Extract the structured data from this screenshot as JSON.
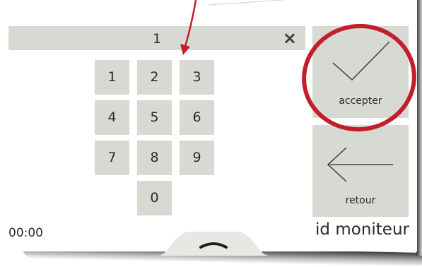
{
  "display": {
    "value": "1"
  },
  "icons": {
    "clear": "×",
    "clear_name": "close-icon",
    "accept_name": "checkmark-icon",
    "back_name": "arrow-left-icon",
    "tab_name": "chevron-up-icon"
  },
  "keypad": {
    "k1": "1",
    "k2": "2",
    "k3": "3",
    "k4": "4",
    "k5": "5",
    "k6": "6",
    "k7": "7",
    "k8": "8",
    "k9": "9",
    "k0": "0"
  },
  "buttons": {
    "accept_label": "accepter",
    "back_label": "retour"
  },
  "status": {
    "timer": "00:00",
    "screen_title": "id moniteur"
  },
  "colors": {
    "key_bg": "#d7dad3",
    "text": "#2b2b2b",
    "annotation_red": "#c41e2a"
  }
}
